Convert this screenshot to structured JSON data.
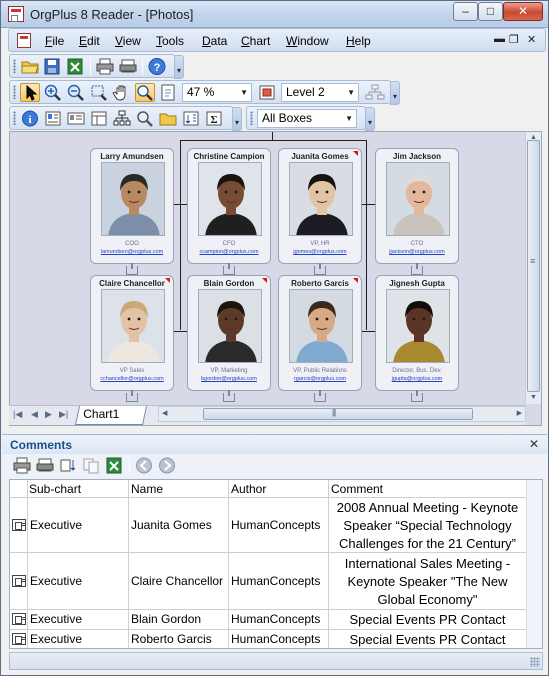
{
  "window": {
    "title": "OrgPlus 8 Reader - [Photos]"
  },
  "menu": {
    "items": [
      {
        "label": "File",
        "key": "F",
        "rest": "ile"
      },
      {
        "label": "Edit",
        "key": "E",
        "rest": "dit"
      },
      {
        "label": "View",
        "key": "V",
        "rest": "iew"
      },
      {
        "label": "Tools",
        "key": "T",
        "rest": "ools"
      },
      {
        "label": "Data",
        "key": "D",
        "rest": "ata"
      },
      {
        "label": "Chart",
        "key": "C",
        "rest": "hart"
      },
      {
        "label": "Window",
        "key": "W",
        "rest": "indow"
      },
      {
        "label": "Help",
        "key": "H",
        "rest": "elp"
      }
    ]
  },
  "toolbar2": {
    "zoom": "47 %",
    "level": "Level 2"
  },
  "toolbar3": {
    "filter": "All Boxes"
  },
  "chart": {
    "boxes": [
      {
        "name": "Larry  Amundsen",
        "title": "COO",
        "email": "lamundsen@orgplus.com",
        "skin": "#b98a62",
        "shirt": "#7d8fa8",
        "hair": "#2a2a2a",
        "bg": "#c9d3df",
        "flag": false
      },
      {
        "name": "Christine  Campion",
        "title": "CFO",
        "email": "ccampion@orgplus.com",
        "skin": "#7a4b34",
        "shirt": "#1f1f1f",
        "hair": "#1a1410",
        "bg": "#dfe4ea",
        "flag": false
      },
      {
        "name": "Juanita  Gomes",
        "title": "VP, HR",
        "email": "jgomes@orgplus.com",
        "skin": "#e2c3a2",
        "shirt": "#1c1c22",
        "hair": "#161210",
        "bg": "#d9dde3",
        "flag": true
      },
      {
        "name": "Jim  Jackson",
        "title": "CTO",
        "email": "jjackson@orgplus.com",
        "skin": "#e3b79b",
        "shirt": "#c8c4bd",
        "hair": "#dcdcdc",
        "bg": "#d5dbe3",
        "flag": false
      },
      {
        "name": "Claire  Chancellor",
        "title": "VP Sales",
        "email": "cchancellor@orgplus.com",
        "skin": "#e4c2a6",
        "shirt": "#ece7df",
        "hair": "#c9a97a",
        "bg": "#dde2e8",
        "flag": true
      },
      {
        "name": "Blain  Gordon",
        "title": "VP, Marketing",
        "email": "bgordon@orgplus.com",
        "skin": "#5d3a28",
        "shirt": "#2a2a2a",
        "hair": "#1d1410",
        "bg": "#dcdfe4",
        "flag": true
      },
      {
        "name": "Roberto  Garcis",
        "title": "VP, Public Relations",
        "email": "rgarcis@orgplus.com",
        "skin": "#d8a985",
        "shirt": "#7fa9cf",
        "hair": "#3a2a1e",
        "bg": "#d4dae2",
        "flag": true
      },
      {
        "name": "Jignesh  Gupta",
        "title": "Director, Bus. Dev.",
        "email": "jgupta@orgplus.com",
        "skin": "#5a3426",
        "shirt": "#a8892f",
        "hair": "#120c0a",
        "bg": "#dfe2e7",
        "flag": false
      }
    ]
  },
  "sheet_tabs": {
    "active": "Chart1"
  },
  "comments": {
    "title": "Comments",
    "columns": [
      "Sub-chart",
      "Name",
      "Author",
      "Comment"
    ],
    "rows": [
      {
        "subchart": "Executive",
        "name": "Juanita  Gomes",
        "author": "HumanConcepts",
        "comment": "2008 Annual Meeting  - Keynote Speaker  “Special Technology Challenges for the 21 Century”"
      },
      {
        "subchart": "Executive",
        "name": "Claire  Chancellor",
        "author": "HumanConcepts",
        "comment": "International Sales Meeting - Keynote Speaker  \"The New Global Economy\""
      },
      {
        "subchart": "Executive",
        "name": "Blain Gordon",
        "author": "HumanConcepts",
        "comment": "Special Events PR Contact"
      },
      {
        "subchart": "Executive",
        "name": "Roberto  Garcis",
        "author": "HumanConcepts",
        "comment": "Special Events PR Contact"
      }
    ]
  },
  "colors": {
    "accent": "#1e4f8d",
    "flag": "#d11a1a",
    "link": "#2340c8"
  }
}
